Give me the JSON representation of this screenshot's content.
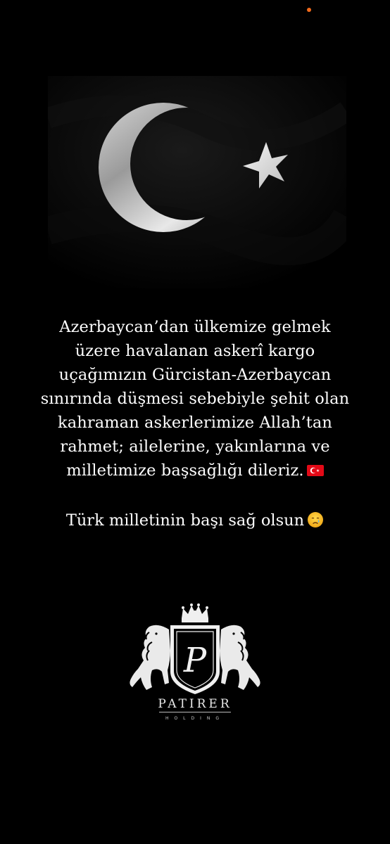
{
  "colors": {
    "background": "#000000",
    "status_dot": "#f26a1b",
    "text": "#ffffff",
    "emblem": "#f2f2f2",
    "turkish_red": "#e30a17"
  },
  "image": {
    "description_icon": "crescent-star-flag-icon"
  },
  "message": {
    "lines": [
      "Azerbaycan’dan ülkemize gelmek",
      "üzere havalanan askerî kargo",
      "uçağımızın Gürcistan-Azerbaycan",
      "sınırında düşmesi sebebiyle şehit olan",
      "kahraman askerlerimize Allah’tan",
      "rahmet; ailelerine, yakınlarına ve",
      "milletimize başsağlığı dileriz."
    ],
    "flag_emoji": "turkey-flag-icon"
  },
  "closing": {
    "text": "Türk milletinin başı sağ olsun",
    "emoji": "crying-face-icon"
  },
  "logo": {
    "monogram": "P",
    "name": "PATIRER",
    "subtitle": "HOLDING"
  }
}
